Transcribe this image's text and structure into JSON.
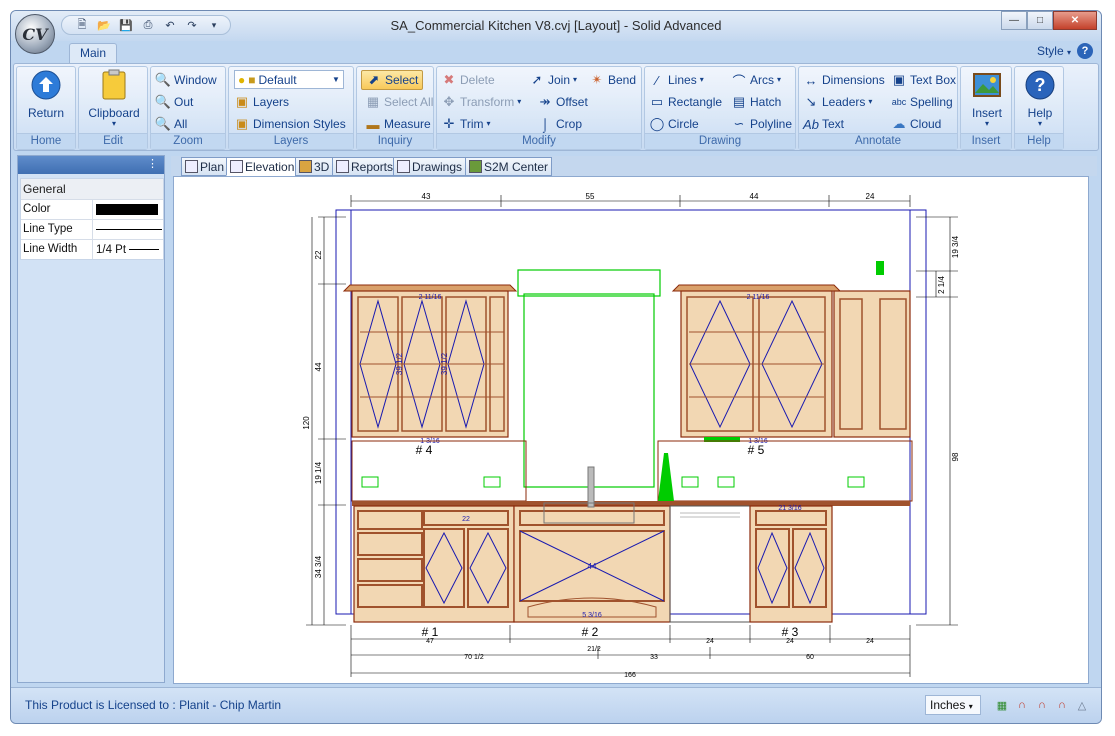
{
  "window": {
    "title": "SA_Commercial Kitchen V8.cvj [Layout] - Solid Advanced",
    "app_logo": "CV"
  },
  "ribbon": {
    "tab_main": "Main",
    "style_label": "Style",
    "home": {
      "label": "Home",
      "return": "Return"
    },
    "edit": {
      "label": "Edit",
      "clipboard": "Clipboard"
    },
    "zoom": {
      "label": "Zoom",
      "window": "Window",
      "out": "Out",
      "all": "All"
    },
    "layers": {
      "label": "Layers",
      "current": "Default",
      "layers": "Layers",
      "dimension_styles": "Dimension Styles"
    },
    "inquiry": {
      "label": "Inquiry",
      "select": "Select",
      "select_all": "Select All",
      "measure": "Measure"
    },
    "modify": {
      "label": "Modify",
      "delete": "Delete",
      "transform": "Transform",
      "trim": "Trim",
      "join": "Join",
      "offset": "Offset",
      "crop": "Crop",
      "bend": "Bend"
    },
    "drawing": {
      "label": "Drawing",
      "lines": "Lines",
      "rectangle": "Rectangle",
      "circle": "Circle",
      "arcs": "Arcs",
      "hatch": "Hatch",
      "polyline": "Polyline"
    },
    "annotate": {
      "label": "Annotate",
      "dimensions": "Dimensions",
      "leaders": "Leaders",
      "text": "Text",
      "text_box": "Text Box",
      "spelling": "Spelling",
      "cloud": "Cloud"
    },
    "insert": {
      "label": "Insert",
      "insert": "Insert"
    },
    "help": {
      "label": "Help",
      "help": "Help"
    }
  },
  "properties": {
    "section": "General",
    "rows": [
      {
        "key": "Color",
        "value": ""
      },
      {
        "key": "Line Type",
        "value": ""
      },
      {
        "key": "Line Width",
        "value": "1/4 Pt"
      }
    ]
  },
  "doc_tabs": [
    "Plan",
    "Elevation",
    "3D",
    "Reports",
    "Drawings",
    "S2M Center"
  ],
  "active_tab": "Elevation",
  "drawing": {
    "top_dims": [
      "43",
      "55",
      "44",
      "24"
    ],
    "left_dims": [
      "22",
      "44",
      "19 1/4",
      "34 3/4"
    ],
    "left_total": "120",
    "right_dims": [
      "19 3/4",
      "2 1/4",
      "98"
    ],
    "cabinet_labels": [
      "# 4",
      "# 5",
      "# 1",
      "# 2",
      "# 3"
    ],
    "bottom_row1": [
      "47",
      "24",
      "24",
      "24"
    ],
    "bottom_mid": "21/2",
    "bottom_row2": [
      "70 1/2",
      "33",
      "60"
    ],
    "bottom_total": "166",
    "misc_labels": [
      "2 11/16",
      "2 11/16",
      "39 1/2",
      "39 1/2",
      "39 1/2",
      "39 1/2",
      "1 3/16",
      "1 3/16",
      "44",
      "5 3/16",
      "21 3/16",
      "22"
    ]
  },
  "status": {
    "license": "This Product is Licensed to : Planit - Chip Martin",
    "units": "Inches"
  },
  "colors": {
    "cabinet": "#a0522d",
    "dimension": "#1a1ab0",
    "highlight": "#00dd00",
    "ribbon": "#d5e4f6"
  }
}
